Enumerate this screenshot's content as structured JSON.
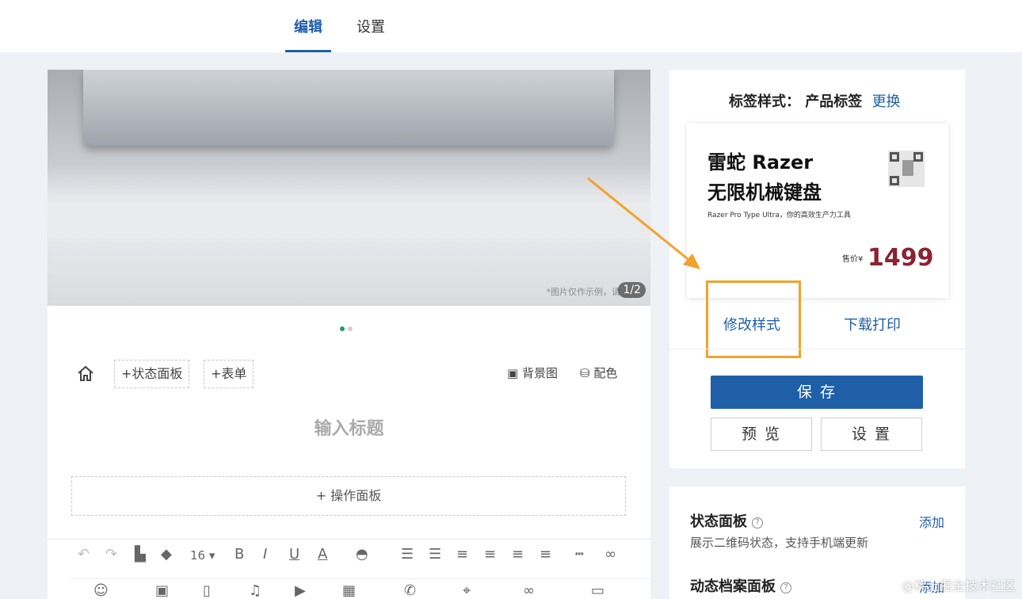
{
  "tabs": [
    {
      "label": "编辑",
      "active": true
    },
    {
      "label": "设置",
      "active": false
    }
  ],
  "image": {
    "note": "*图片仅作示例，请",
    "counter": "1/2",
    "dots": [
      "#1a9b6c",
      "#d0d0d0"
    ]
  },
  "toolbar": {
    "status_panel": "+状态面板",
    "form": "+表单",
    "background": "背景图",
    "color": "配色"
  },
  "title_placeholder": "输入标题",
  "op_panel": "+ 操作面板",
  "format_bar": {
    "font_size": "16",
    "items": [
      "bold-icon",
      "italic-icon",
      "underline-icon",
      "text-color-icon",
      "highlight-icon",
      "ordered-list-icon",
      "bullet-list-icon",
      "align-left-icon",
      "align-center-icon",
      "align-right-icon",
      "align-justify-icon",
      "divider-icon",
      "link-icon"
    ]
  },
  "label": {
    "style_label": "标签样式：",
    "style_value": "产品标签",
    "change": "更换",
    "preview": {
      "name_line1": "雷蛇 Razer",
      "name_line2": "无限机械键盘",
      "subtitle": "Razer Pro Type Ultra，你的高效生产力工具",
      "price_label": "售价¥",
      "price": "1499"
    },
    "modify": "修改样式",
    "download": "下载打印",
    "save": "保 存",
    "preview_btn": "预 览",
    "settings_btn": "设 置"
  },
  "panels": {
    "status_title": "状态面板",
    "status_add": "添加",
    "status_desc": "展示二维码状态，支持手机端更新",
    "archive_title": "动态档案面板",
    "archive_add": "添加"
  },
  "watermark": "@稀土掘金技术社区",
  "colors": {
    "accent": "#1f5fa8",
    "highlight": "#f2a22c",
    "price": "#8b2331"
  }
}
